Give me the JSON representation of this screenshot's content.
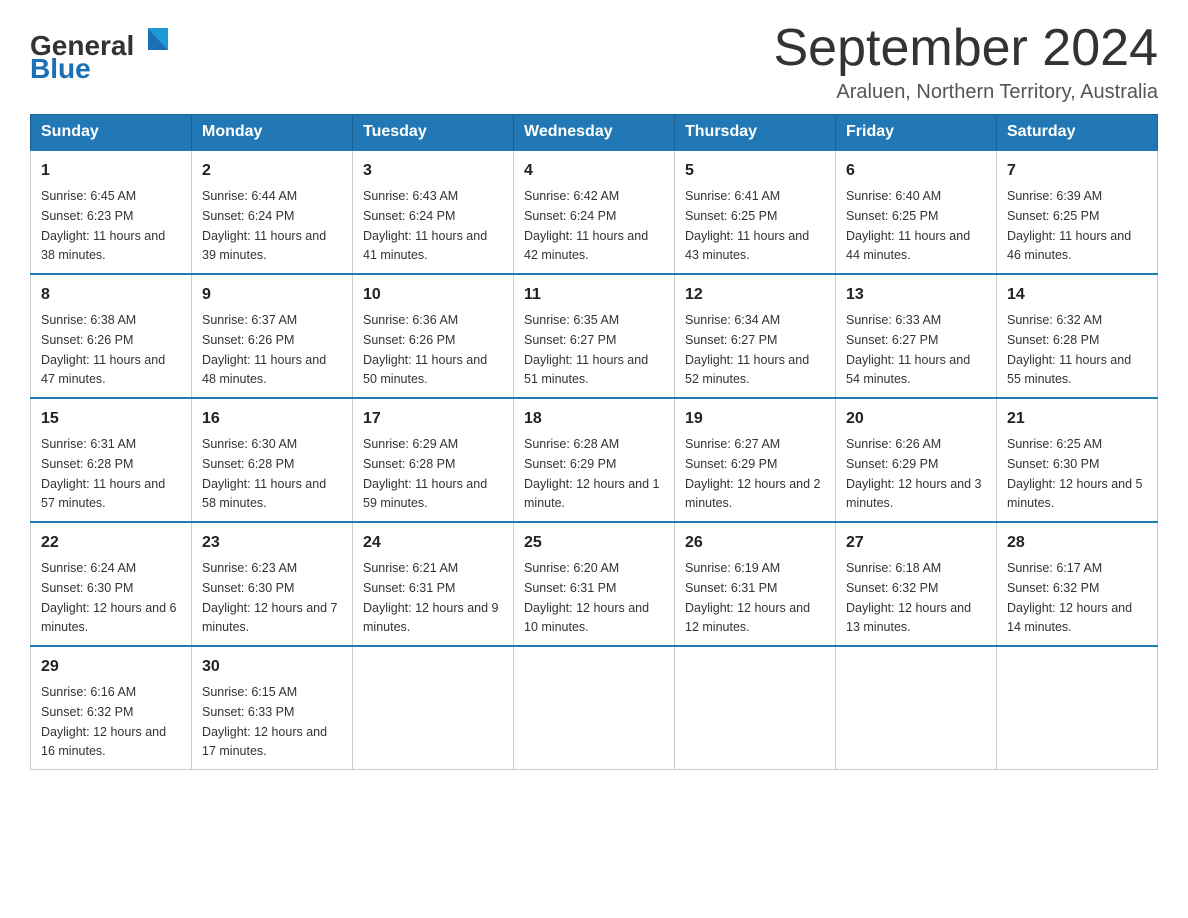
{
  "header": {
    "logo_general": "General",
    "logo_blue": "Blue",
    "month_year": "September 2024",
    "location": "Araluen, Northern Territory, Australia"
  },
  "days_of_week": [
    "Sunday",
    "Monday",
    "Tuesday",
    "Wednesday",
    "Thursday",
    "Friday",
    "Saturday"
  ],
  "weeks": [
    [
      {
        "day": "1",
        "sunrise": "6:45 AM",
        "sunset": "6:23 PM",
        "daylight": "11 hours and 38 minutes."
      },
      {
        "day": "2",
        "sunrise": "6:44 AM",
        "sunset": "6:24 PM",
        "daylight": "11 hours and 39 minutes."
      },
      {
        "day": "3",
        "sunrise": "6:43 AM",
        "sunset": "6:24 PM",
        "daylight": "11 hours and 41 minutes."
      },
      {
        "day": "4",
        "sunrise": "6:42 AM",
        "sunset": "6:24 PM",
        "daylight": "11 hours and 42 minutes."
      },
      {
        "day": "5",
        "sunrise": "6:41 AM",
        "sunset": "6:25 PM",
        "daylight": "11 hours and 43 minutes."
      },
      {
        "day": "6",
        "sunrise": "6:40 AM",
        "sunset": "6:25 PM",
        "daylight": "11 hours and 44 minutes."
      },
      {
        "day": "7",
        "sunrise": "6:39 AM",
        "sunset": "6:25 PM",
        "daylight": "11 hours and 46 minutes."
      }
    ],
    [
      {
        "day": "8",
        "sunrise": "6:38 AM",
        "sunset": "6:26 PM",
        "daylight": "11 hours and 47 minutes."
      },
      {
        "day": "9",
        "sunrise": "6:37 AM",
        "sunset": "6:26 PM",
        "daylight": "11 hours and 48 minutes."
      },
      {
        "day": "10",
        "sunrise": "6:36 AM",
        "sunset": "6:26 PM",
        "daylight": "11 hours and 50 minutes."
      },
      {
        "day": "11",
        "sunrise": "6:35 AM",
        "sunset": "6:27 PM",
        "daylight": "11 hours and 51 minutes."
      },
      {
        "day": "12",
        "sunrise": "6:34 AM",
        "sunset": "6:27 PM",
        "daylight": "11 hours and 52 minutes."
      },
      {
        "day": "13",
        "sunrise": "6:33 AM",
        "sunset": "6:27 PM",
        "daylight": "11 hours and 54 minutes."
      },
      {
        "day": "14",
        "sunrise": "6:32 AM",
        "sunset": "6:28 PM",
        "daylight": "11 hours and 55 minutes."
      }
    ],
    [
      {
        "day": "15",
        "sunrise": "6:31 AM",
        "sunset": "6:28 PM",
        "daylight": "11 hours and 57 minutes."
      },
      {
        "day": "16",
        "sunrise": "6:30 AM",
        "sunset": "6:28 PM",
        "daylight": "11 hours and 58 minutes."
      },
      {
        "day": "17",
        "sunrise": "6:29 AM",
        "sunset": "6:28 PM",
        "daylight": "11 hours and 59 minutes."
      },
      {
        "day": "18",
        "sunrise": "6:28 AM",
        "sunset": "6:29 PM",
        "daylight": "12 hours and 1 minute."
      },
      {
        "day": "19",
        "sunrise": "6:27 AM",
        "sunset": "6:29 PM",
        "daylight": "12 hours and 2 minutes."
      },
      {
        "day": "20",
        "sunrise": "6:26 AM",
        "sunset": "6:29 PM",
        "daylight": "12 hours and 3 minutes."
      },
      {
        "day": "21",
        "sunrise": "6:25 AM",
        "sunset": "6:30 PM",
        "daylight": "12 hours and 5 minutes."
      }
    ],
    [
      {
        "day": "22",
        "sunrise": "6:24 AM",
        "sunset": "6:30 PM",
        "daylight": "12 hours and 6 minutes."
      },
      {
        "day": "23",
        "sunrise": "6:23 AM",
        "sunset": "6:30 PM",
        "daylight": "12 hours and 7 minutes."
      },
      {
        "day": "24",
        "sunrise": "6:21 AM",
        "sunset": "6:31 PM",
        "daylight": "12 hours and 9 minutes."
      },
      {
        "day": "25",
        "sunrise": "6:20 AM",
        "sunset": "6:31 PM",
        "daylight": "12 hours and 10 minutes."
      },
      {
        "day": "26",
        "sunrise": "6:19 AM",
        "sunset": "6:31 PM",
        "daylight": "12 hours and 12 minutes."
      },
      {
        "day": "27",
        "sunrise": "6:18 AM",
        "sunset": "6:32 PM",
        "daylight": "12 hours and 13 minutes."
      },
      {
        "day": "28",
        "sunrise": "6:17 AM",
        "sunset": "6:32 PM",
        "daylight": "12 hours and 14 minutes."
      }
    ],
    [
      {
        "day": "29",
        "sunrise": "6:16 AM",
        "sunset": "6:32 PM",
        "daylight": "12 hours and 16 minutes."
      },
      {
        "day": "30",
        "sunrise": "6:15 AM",
        "sunset": "6:33 PM",
        "daylight": "12 hours and 17 minutes."
      },
      null,
      null,
      null,
      null,
      null
    ]
  ]
}
